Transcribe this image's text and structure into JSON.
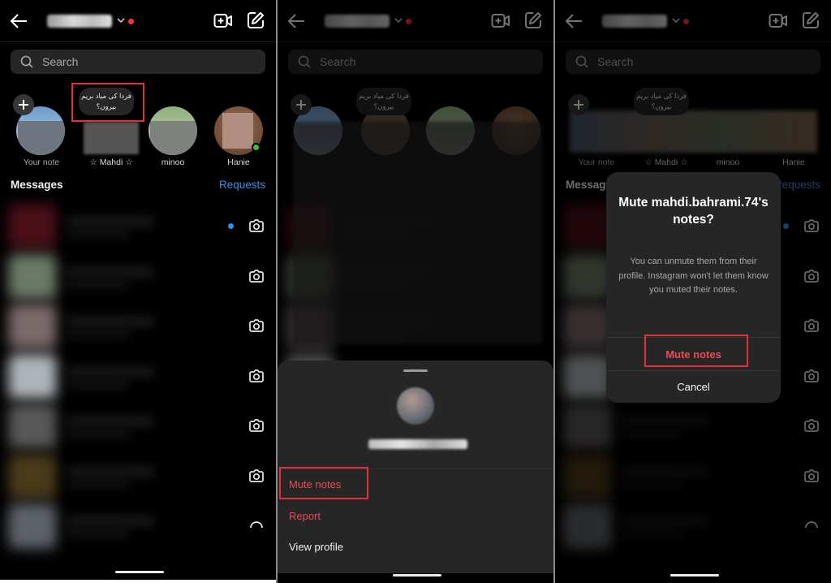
{
  "colors": {
    "accent_blue": "#3a8fe0",
    "destructive_red": "#ed4956",
    "highlight_box": "#e0313a",
    "sheet_bg": "#262626",
    "online_green": "#3ec034"
  },
  "inbox": {
    "header": {
      "back_icon": "arrow-left-icon",
      "username": "[blurred username]",
      "chevron_icon": "chevron-down-icon",
      "new_video_icon": "video-plus-icon",
      "compose_icon": "edit-icon"
    },
    "search": {
      "placeholder": "Search"
    },
    "notes": [
      {
        "label": "Your note",
        "note_text": ""
      },
      {
        "label": "☆ Mahdi ☆",
        "note_text": "فردا کی میاد بریم بیرون؟"
      },
      {
        "label": "minoo",
        "note_text": ""
      },
      {
        "label": "Hanie",
        "note_text": "",
        "online": true
      }
    ],
    "messages_title": "Messages",
    "requests_label": "Requests",
    "rows": [
      {
        "unread": true
      },
      {
        "unread": false
      },
      {
        "unread": false
      },
      {
        "unread": false
      },
      {
        "unread": false
      },
      {
        "unread": false
      },
      {
        "unread": false
      }
    ]
  },
  "bottom_sheet": {
    "username": "[blurred: mahdi.bahrami.74]",
    "items": [
      {
        "label": "Mute notes",
        "style": "destructive"
      },
      {
        "label": "Report",
        "style": "destructive"
      },
      {
        "label": "View profile",
        "style": "normal"
      }
    ]
  },
  "dialog": {
    "title": "Mute mahdi.bahrami.74's notes?",
    "body": "You can unmute them from their profile. Instagram won't let them know you muted their notes.",
    "confirm_label": "Mute notes",
    "cancel_label": "Cancel"
  }
}
